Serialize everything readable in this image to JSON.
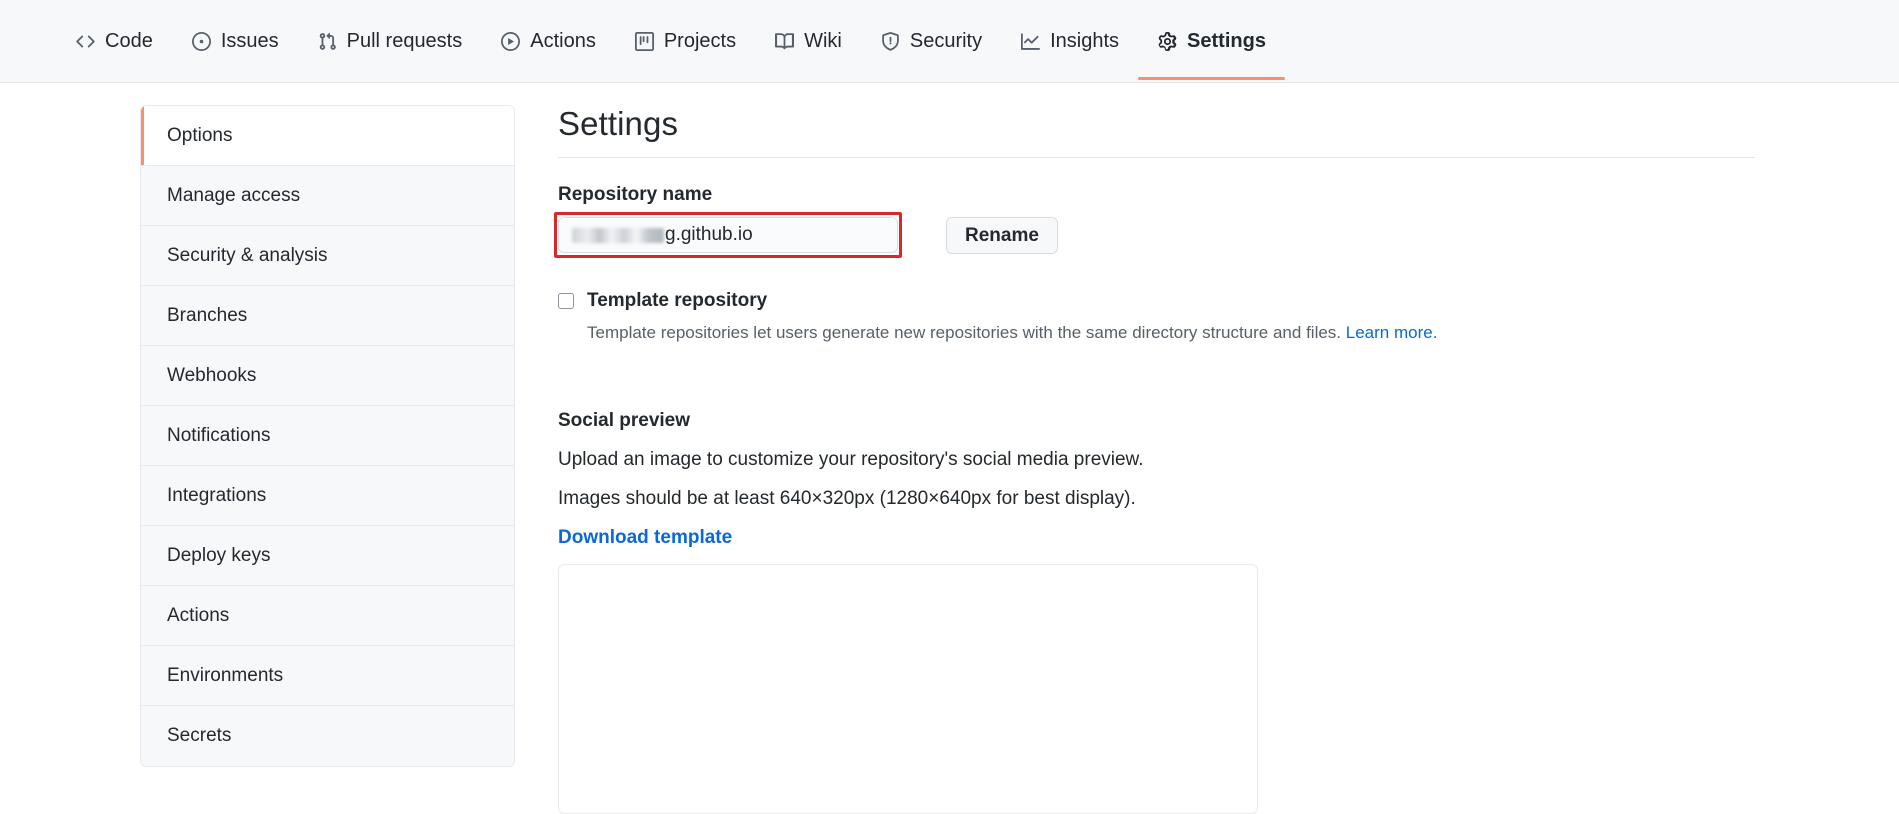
{
  "repo_nav": {
    "items": [
      {
        "label": "Code",
        "icon": "code-icon",
        "active": false
      },
      {
        "label": "Issues",
        "icon": "issue-opened-icon",
        "active": false
      },
      {
        "label": "Pull requests",
        "icon": "git-pull-request-icon",
        "active": false
      },
      {
        "label": "Actions",
        "icon": "play-circle-icon",
        "active": false
      },
      {
        "label": "Projects",
        "icon": "project-board-icon",
        "active": false
      },
      {
        "label": "Wiki",
        "icon": "book-icon",
        "active": false
      },
      {
        "label": "Security",
        "icon": "shield-icon",
        "active": false
      },
      {
        "label": "Insights",
        "icon": "graph-icon",
        "active": false
      },
      {
        "label": "Settings",
        "icon": "gear-icon",
        "active": true
      }
    ],
    "active_underline_color": "#fd8c73"
  },
  "sidebar": {
    "items": [
      {
        "label": "Options",
        "active": true
      },
      {
        "label": "Manage access",
        "active": false
      },
      {
        "label": "Security & analysis",
        "active": false
      },
      {
        "label": "Branches",
        "active": false
      },
      {
        "label": "Webhooks",
        "active": false
      },
      {
        "label": "Notifications",
        "active": false
      },
      {
        "label": "Integrations",
        "active": false
      },
      {
        "label": "Deploy keys",
        "active": false
      },
      {
        "label": "Actions",
        "active": false
      },
      {
        "label": "Environments",
        "active": false
      },
      {
        "label": "Secrets",
        "active": false
      }
    ],
    "active_marker_color": "#fd8c73"
  },
  "main": {
    "page_title": "Settings",
    "repository_name": {
      "label": "Repository name",
      "value_visible_suffix": "g.github.io",
      "value_redacted": true,
      "rename_button": "Rename",
      "annotation_color": "#d7282d"
    },
    "template_repository": {
      "label": "Template repository",
      "checked": false,
      "description": "Template repositories let users generate new repositories with the same directory structure and files.",
      "learn_more": "Learn more."
    },
    "social_preview": {
      "title": "Social preview",
      "line1": "Upload an image to customize your repository's social media preview.",
      "line2": "Images should be at least 640×320px (1280×640px for best display).",
      "download_template": "Download template"
    }
  }
}
